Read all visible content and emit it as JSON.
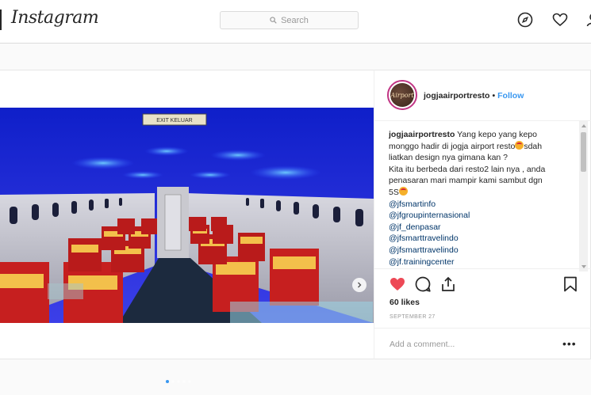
{
  "app": {
    "logo_text": "Instagram"
  },
  "search": {
    "placeholder": "Search"
  },
  "nav": {
    "icons": [
      "compass-icon",
      "heart-icon",
      "user-icon"
    ]
  },
  "post": {
    "author": "jogjaairportresto",
    "separator": "•",
    "follow_label": "Follow",
    "avatar_text": "Airport",
    "caption": {
      "line1": "Yang kepo yang kepo",
      "line2": "monggo hadir di jogja airport resto",
      "line2b": "sdah",
      "line3": "liatkan design nya gimana kan ?",
      "line4": "Kita itu berbeda dari resto2 lain nya , anda",
      "line5": "penasaran mari mampir kami sambut dgn",
      "line6": "5S",
      "tags": [
        "@jfsmartinfo",
        "@jfgroupinternasional",
        "@jf_denpasar",
        "@jfsmarttravelindo",
        "@jfsmarttravelindo",
        "@jf.trainingcenter"
      ]
    },
    "likes": "60 likes",
    "date": "SEPTEMBER 27",
    "comment_placeholder": "Add a comment...",
    "more_label": "•••",
    "carousel": {
      "slides": 5,
      "current": 1
    },
    "cabin_sign": "EXIT KELUAR"
  },
  "colors": {
    "accent": "#3897f0",
    "like": "#ed4956",
    "ceiling": "#1a2bd8"
  }
}
